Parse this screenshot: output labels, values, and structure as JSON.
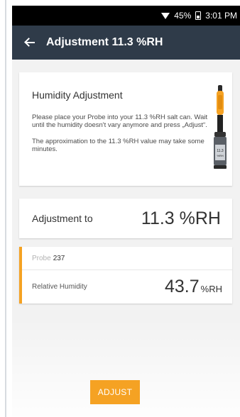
{
  "statusbar": {
    "battery": "45%",
    "time": "3:01 PM"
  },
  "appbar": {
    "title": "Adjustment 11.3 %RH"
  },
  "info": {
    "title": "Humidity Adjustment",
    "paragraph1": "Please place your Probe into your 11.3 %RH salt can. Wait until the humidity doesn't vary anymore and press „Adjust“.",
    "paragraph2": "The approximation to the 11.3 %RH value may take some minutes.",
    "can_label": "11.3",
    "can_unit": "%RH"
  },
  "adjustment": {
    "label": "Adjustment to",
    "value": "11.3 %RH"
  },
  "probe": {
    "prefix": "Probe",
    "name": "237",
    "reading_label": "Relative Humidity",
    "reading_value": "43.7",
    "reading_unit": "%RH"
  },
  "actions": {
    "adjust_label": "ADJUST"
  },
  "colors": {
    "accent": "#f5a223",
    "appbar": "#2f3b49",
    "statusbar": "#000000",
    "background": "#f2f2f2"
  }
}
